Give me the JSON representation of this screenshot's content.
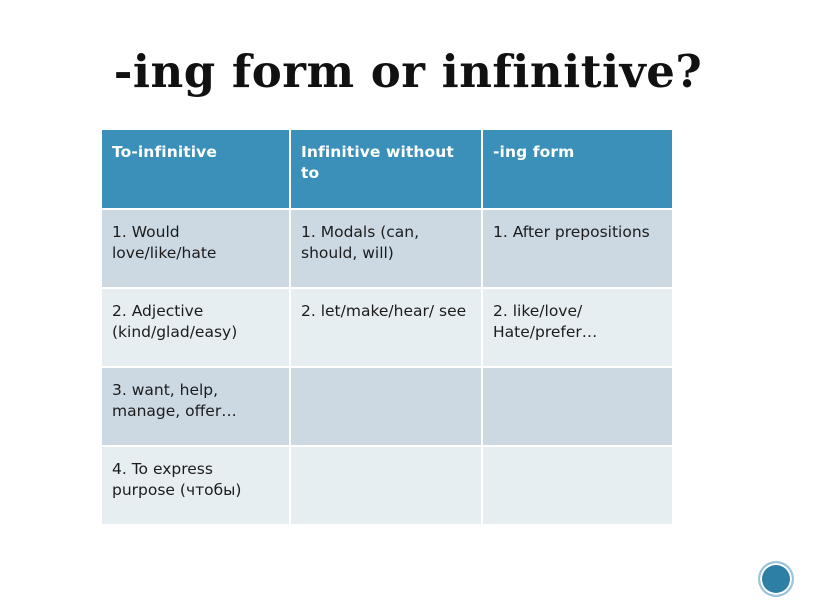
{
  "slide": {
    "title": "-ing form or infinitive?",
    "background_color": "#ffffff"
  },
  "table": {
    "header_bg": "#3a90b8",
    "header_text_color": "#ffffff",
    "row_dark_bg": "#ccd9e3",
    "row_light_bg": "#e7eef1",
    "columns": [
      {
        "label": "To-infinitive"
      },
      {
        "label": "Infinitive without to"
      },
      {
        "label": "-ing form"
      }
    ],
    "rows": [
      {
        "shade": "dark",
        "cells": [
          "1. Would love/like/hate",
          "1. Modals (can, should, will)",
          "1. After prepositions"
        ]
      },
      {
        "shade": "light",
        "cells": [
          "2. Adjective (kind/glad/easy)",
          "2. let/make/hear/ see",
          "2. like/love/ Hate/prefer…"
        ]
      },
      {
        "shade": "dark",
        "cells": [
          "3. want, help, manage, offer…",
          "",
          ""
        ]
      },
      {
        "shade": "light",
        "cells": [
          "4. To express purpose (чтобы)",
          "",
          ""
        ]
      }
    ]
  },
  "nav": {
    "circle_label": "",
    "circle_color": "#2e7fa6",
    "circle_ring_color": "#9dc4d8"
  }
}
